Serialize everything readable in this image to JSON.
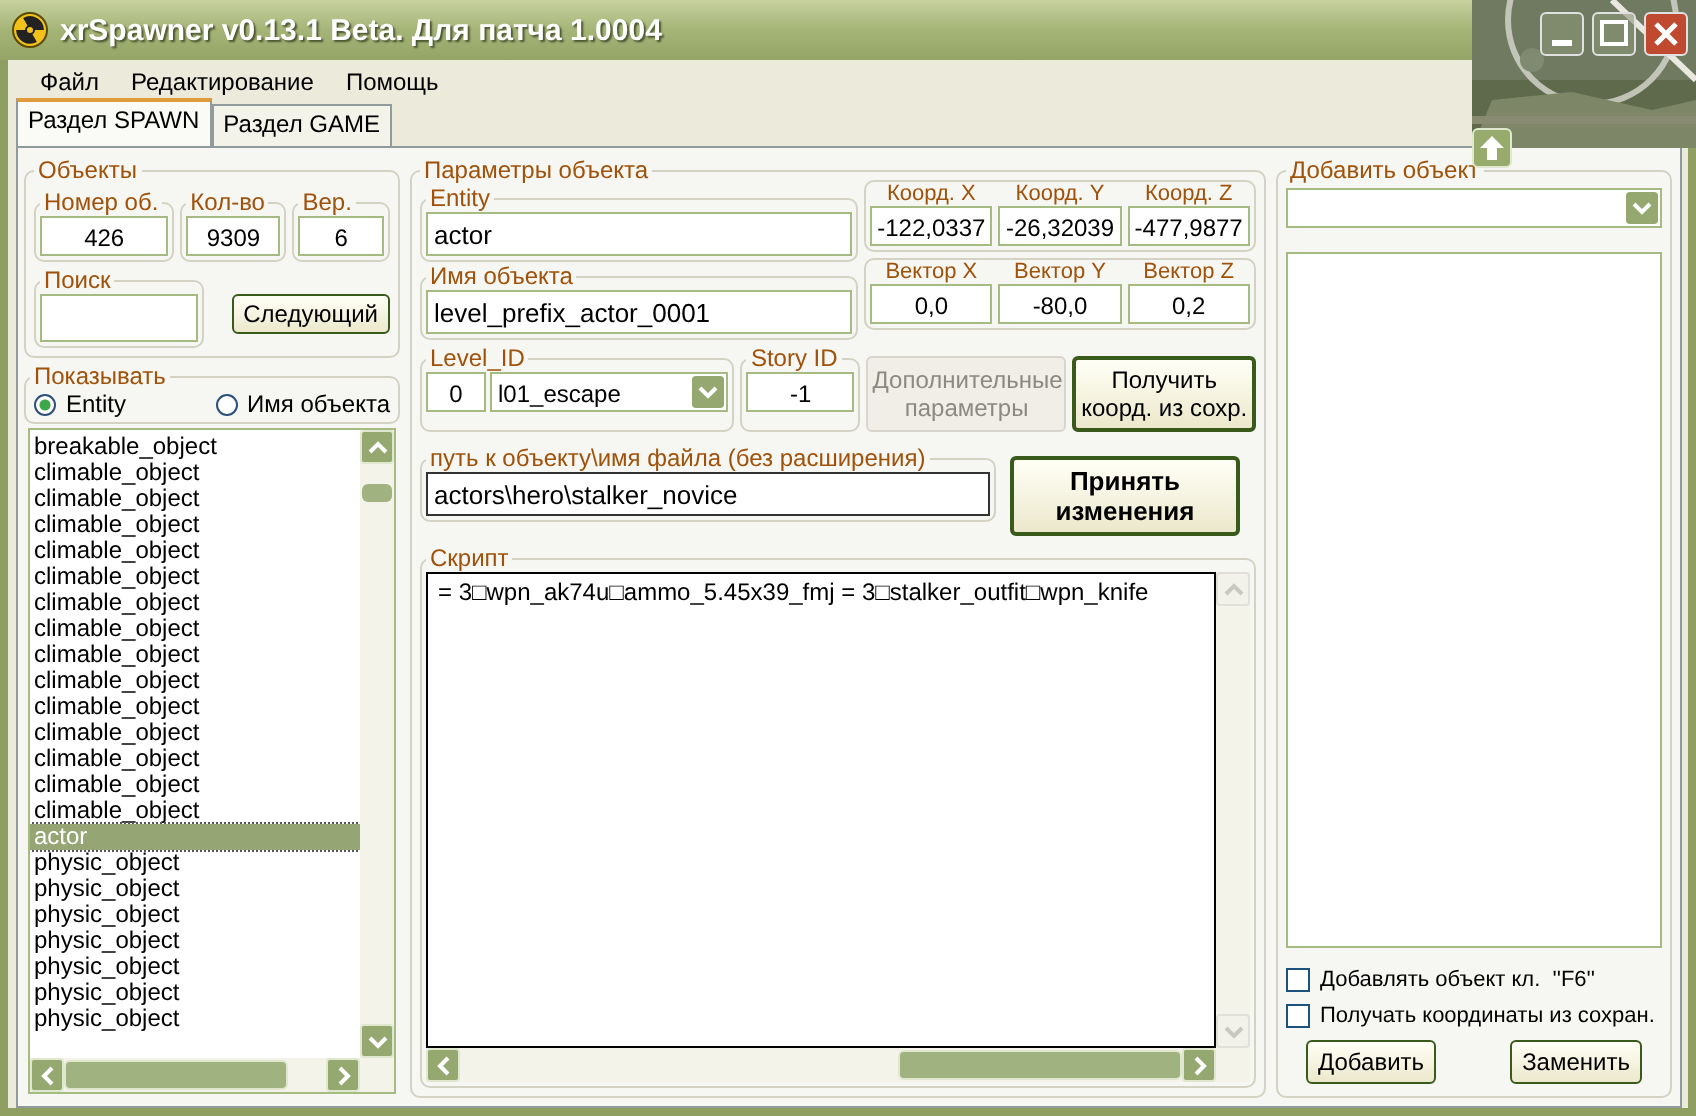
{
  "window": {
    "title": "xrSpawner v0.13.1 Beta. Для патча 1.0004"
  },
  "menu": [
    "Файл",
    "Редактирование",
    "Помощь"
  ],
  "tabs": [
    {
      "label": "Раздел SPAWN",
      "selected": true
    },
    {
      "label": "Раздел GAME",
      "selected": false
    }
  ],
  "objects": {
    "title": "Объекты",
    "counters": [
      {
        "label": "Номер об.",
        "value": "426"
      },
      {
        "label": "Кол-во",
        "value": "9309"
      },
      {
        "label": "Вер.",
        "value": "6"
      }
    ]
  },
  "search": {
    "label": "Поиск",
    "button": "Следующий"
  },
  "show": {
    "label": "Показывать",
    "options": [
      {
        "label": "Entity",
        "selected": true
      },
      {
        "label": "Имя объекта",
        "selected": false
      }
    ]
  },
  "object_list": [
    {
      "text": "breakable_object",
      "selected": false
    },
    {
      "text": "climable_object",
      "selected": false
    },
    {
      "text": "climable_object",
      "selected": false
    },
    {
      "text": "climable_object",
      "selected": false
    },
    {
      "text": "climable_object",
      "selected": false
    },
    {
      "text": "climable_object",
      "selected": false
    },
    {
      "text": "climable_object",
      "selected": false
    },
    {
      "text": "climable_object",
      "selected": false
    },
    {
      "text": "climable_object",
      "selected": false
    },
    {
      "text": "climable_object",
      "selected": false
    },
    {
      "text": "climable_object",
      "selected": false
    },
    {
      "text": "climable_object",
      "selected": false
    },
    {
      "text": "climable_object",
      "selected": false
    },
    {
      "text": "climable_object",
      "selected": false
    },
    {
      "text": "climable_object",
      "selected": false
    },
    {
      "text": "actor",
      "selected": true
    },
    {
      "text": "physic_object",
      "selected": false
    },
    {
      "text": "physic_object",
      "selected": false
    },
    {
      "text": "physic_object",
      "selected": false
    },
    {
      "text": "physic_object",
      "selected": false
    },
    {
      "text": "physic_object",
      "selected": false
    },
    {
      "text": "physic_object",
      "selected": false
    },
    {
      "text": "physic_object",
      "selected": false
    }
  ],
  "params": {
    "title": "Параметры объекта",
    "entity": {
      "label": "Entity",
      "value": "actor"
    },
    "name": {
      "label": "Имя объекта",
      "value": "level_prefix_actor_0001"
    },
    "coords": [
      {
        "label": "Коорд. X",
        "value": "-122,0337"
      },
      {
        "label": "Коорд. Y",
        "value": "-26,32039"
      },
      {
        "label": "Коорд. Z",
        "value": "-477,9877"
      }
    ],
    "vectors": [
      {
        "label": "Вектор  X",
        "value": "0,0"
      },
      {
        "label": "Вектор Y",
        "value": "-80,0"
      },
      {
        "label": "Вектор Z",
        "value": "0,2"
      }
    ],
    "level_id": {
      "label": "Level_ID",
      "number": "0",
      "value": "l01_escape"
    },
    "story_id": {
      "label": "Story ID",
      "value": "-1"
    },
    "extra_button": {
      "label": "Дополнительные параметры",
      "disabled": true
    },
    "get_coords_button": "Получить коорд. из сохр.",
    "path": {
      "label": "путь к объекту\\имя файла (без расширения)",
      "value": "actors\\hero\\stalker_novice"
    },
    "apply_button": "Принять изменения",
    "script": {
      "label": "Скрипт",
      "value": "= 3□wpn_ak74u□ammo_5.45x39_fmj = 3□stalker_outfit□wpn_knife"
    }
  },
  "add_object": {
    "title": "Добавить объект",
    "checkboxes": [
      {
        "label": "Добавлять объект кл.  ''F6''",
        "checked": false
      },
      {
        "label": "Получать координаты из сохран.",
        "checked": false
      }
    ],
    "buttons": [
      "Добавить",
      "Заменить"
    ]
  }
}
